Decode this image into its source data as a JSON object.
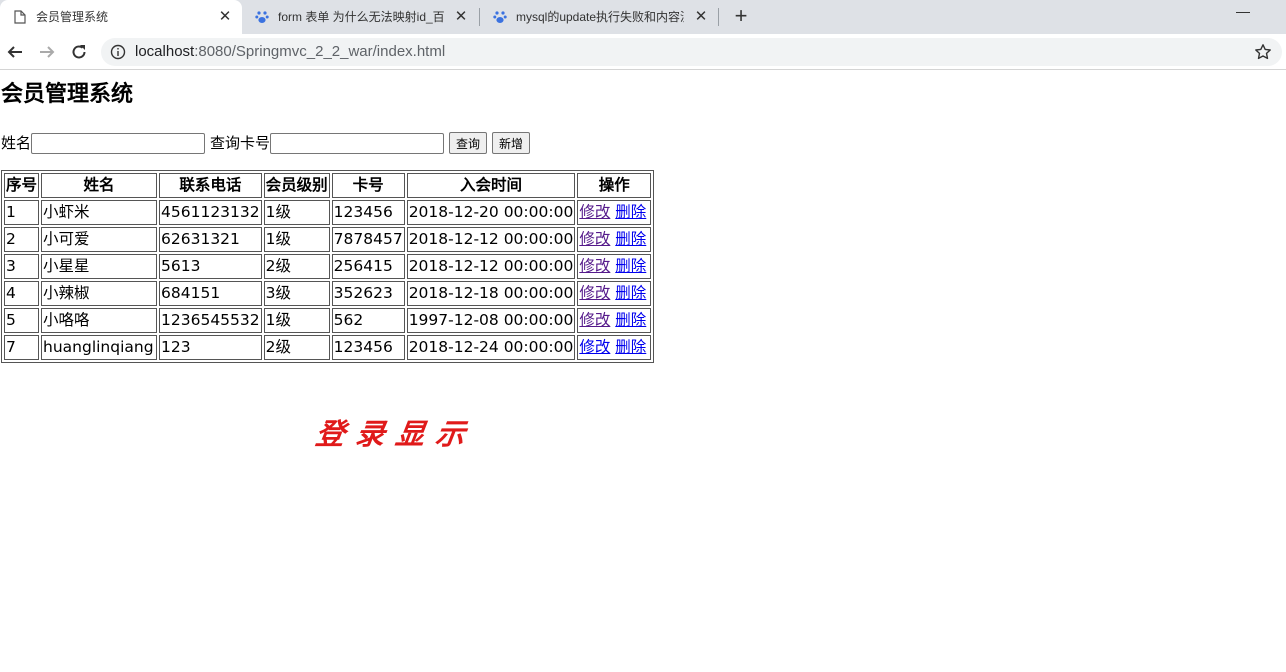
{
  "browser": {
    "tabs": [
      {
        "title": "会员管理系统",
        "active": true,
        "icon": "page-icon"
      },
      {
        "title": "form 表单 为什么无法映射id_百度",
        "active": false,
        "icon": "baidu-paw-icon"
      },
      {
        "title": "mysql的update执行失败和内容没",
        "active": false,
        "icon": "baidu-paw-icon"
      }
    ],
    "url_host": "localhost",
    "url_rest": ":8080/Springmvc_2_2_war/index.html",
    "accent": "#3b72e0"
  },
  "page": {
    "title": "会员管理系统",
    "search": {
      "name_label": "姓名",
      "name_value": "",
      "card_label": "查询卡号",
      "card_value": "",
      "query_button": "查询",
      "add_button": "新增"
    },
    "table": {
      "headers": [
        "序号",
        "姓名",
        "联系电话",
        "会员级别",
        "卡号",
        "入会时间",
        "操作"
      ],
      "rows": [
        {
          "id": "1",
          "name": "小虾米",
          "phone": "4561123132",
          "level": "1级",
          "card": "123456",
          "joined": "2018-12-20 00:00:00",
          "edit": "修改",
          "delete": "删除",
          "edit_visited": true
        },
        {
          "id": "2",
          "name": "小可爱",
          "phone": "62631321",
          "level": "1级",
          "card": "7878457",
          "joined": "2018-12-12 00:00:00",
          "edit": "修改",
          "delete": "删除",
          "edit_visited": true
        },
        {
          "id": "3",
          "name": "小星星",
          "phone": "5613",
          "level": "2级",
          "card": "256415",
          "joined": "2018-12-12 00:00:00",
          "edit": "修改",
          "delete": "删除",
          "edit_visited": true
        },
        {
          "id": "4",
          "name": "小辣椒",
          "phone": "684151",
          "level": "3级",
          "card": "352623",
          "joined": "2018-12-18 00:00:00",
          "edit": "修改",
          "delete": "删除",
          "edit_visited": true
        },
        {
          "id": "5",
          "name": "小咯咯",
          "phone": "1236545532",
          "level": "1级",
          "card": "562",
          "joined": "1997-12-08 00:00:00",
          "edit": "修改",
          "delete": "删除",
          "edit_visited": true
        },
        {
          "id": "7",
          "name": "huanglinqiang",
          "phone": "123",
          "level": "2级",
          "card": "123456",
          "joined": "2018-12-24 00:00:00",
          "edit": "修改",
          "delete": "删除",
          "edit_visited": false
        }
      ]
    },
    "watermark": "登录显示",
    "link_color": "#0000ee",
    "visited_link_color": "#551a8b",
    "watermark_color": "#e01a1a"
  }
}
